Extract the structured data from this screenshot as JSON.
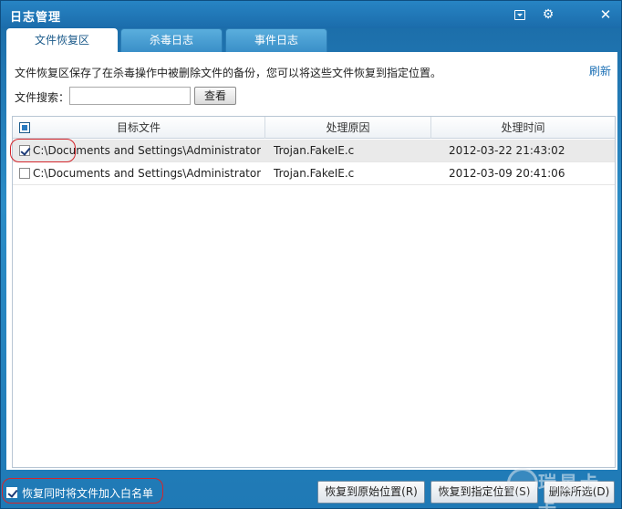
{
  "window": {
    "title": "日志管理"
  },
  "titlebar": {
    "menu_icon": "menu-box-icon",
    "gear_icon": "gear-icon",
    "close_icon": "close-icon",
    "gear_glyph": "⚙",
    "close_glyph": "✕"
  },
  "tabs": [
    {
      "label": "文件恢复区",
      "active": true
    },
    {
      "label": "杀毒日志",
      "active": false
    },
    {
      "label": "事件日志",
      "active": false
    }
  ],
  "panel": {
    "description": "文件恢复区保存了在杀毒操作中被删除文件的备份，您可以将这些文件恢复到指定位置。",
    "refresh_label": "刷新",
    "search_label": "文件搜索：",
    "search_value": "",
    "search_button": "查看"
  },
  "table": {
    "columns": [
      "目标文件",
      "处理原因",
      "处理时间"
    ],
    "rows": [
      {
        "checked": true,
        "file": "C:\\Documents and Settings\\Administrator\\...",
        "reason": "Trojan.FakeIE.c",
        "time": "2012-03-22 21:43:02",
        "selected": true
      },
      {
        "checked": false,
        "file": "C:\\Documents and Settings\\Administrator\\...",
        "reason": "Trojan.FakeIE.c",
        "time": "2012-03-09 20:41:06",
        "selected": false
      }
    ]
  },
  "footer": {
    "whitelist_checked": true,
    "whitelist_label": "恢复同时将文件加入白名单",
    "restore_original": "恢复到原始位置(R)",
    "restore_specified": "恢复到指定位置(S)",
    "delete_selected": "删除所选(D)"
  },
  "watermark": {
    "text": "瑞星卡卡"
  },
  "colors": {
    "title_bar": "#1b6cab",
    "accent": "#2a7bc0",
    "annotation": "#d4262c",
    "link": "#1a6fb5"
  }
}
